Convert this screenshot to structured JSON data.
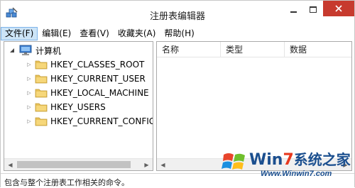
{
  "window": {
    "title": "注册表编辑器",
    "app_icon": "regedit-icon"
  },
  "menu": [
    {
      "label": "文件(F)",
      "active": true
    },
    {
      "label": "编辑(E)",
      "active": false
    },
    {
      "label": "查看(V)",
      "active": false
    },
    {
      "label": "收藏夹(A)",
      "active": false
    },
    {
      "label": "帮助(H)",
      "active": false
    }
  ],
  "tree": {
    "root": {
      "label": "计算机",
      "icon": "computer-icon",
      "expanded": true
    },
    "children": [
      {
        "label": "HKEY_CLASSES_ROOT",
        "icon": "folder-icon"
      },
      {
        "label": "HKEY_CURRENT_USER",
        "icon": "folder-icon"
      },
      {
        "label": "HKEY_LOCAL_MACHINE",
        "icon": "folder-icon"
      },
      {
        "label": "HKEY_USERS",
        "icon": "folder-icon"
      },
      {
        "label": "HKEY_CURRENT_CONFIG",
        "icon": "folder-icon"
      }
    ]
  },
  "list": {
    "columns": [
      "名称",
      "类型",
      "数据"
    ]
  },
  "status": {
    "text": "包含与整个注册表工作相关的命令。"
  },
  "watermark": {
    "brand_part1": "Win",
    "brand_part2": "7",
    "brand_part3": "系统之家",
    "url": "Www.Winwin7.com"
  },
  "colors": {
    "close_button": "#c73a2e",
    "menu_active_bg": "#cce4f7",
    "folder": "#e8c25a"
  }
}
